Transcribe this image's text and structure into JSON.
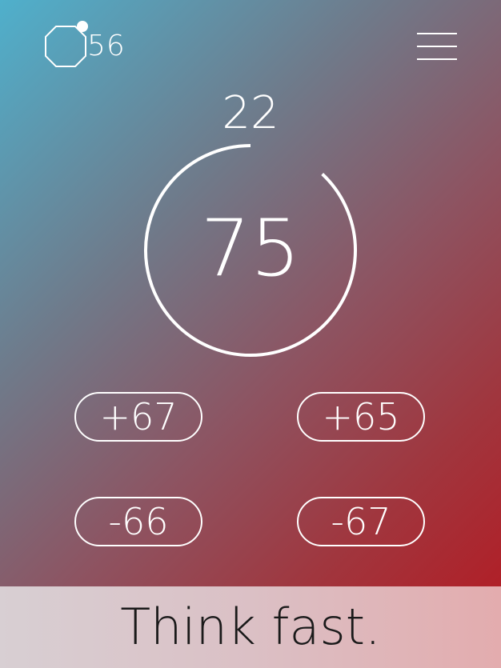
{
  "header": {
    "score": "56",
    "score_icon": "octagon-icon",
    "menu_icon": "hamburger-menu-icon"
  },
  "timer": {
    "seconds": "22",
    "progress_remaining": 0.88
  },
  "target": {
    "value": "75"
  },
  "options": [
    {
      "label": "+67"
    },
    {
      "label": "+65"
    },
    {
      "label": "-66"
    },
    {
      "label": "-67"
    }
  ],
  "footer": {
    "tagline": "Think fast."
  },
  "colors": {
    "gradient_start": "#4fb0cc",
    "gradient_end": "#b02028",
    "foreground": "#ffffff",
    "footer_text": "#1a1a1a"
  }
}
